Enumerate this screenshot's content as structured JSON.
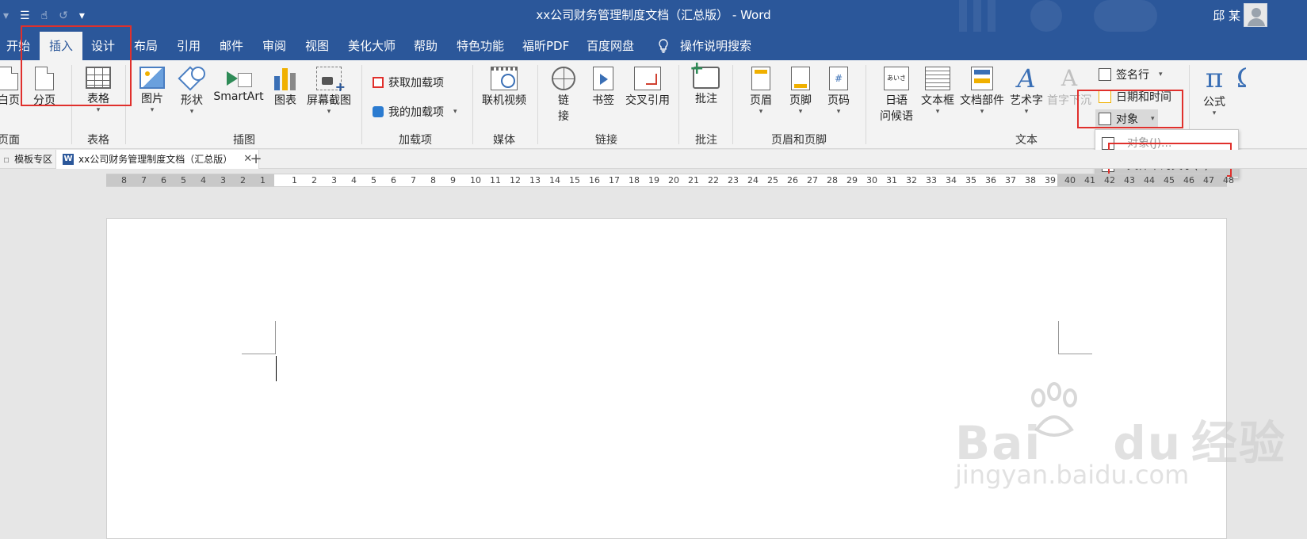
{
  "window": {
    "title": "xx公司财务管理制度文档（汇总版） - Word",
    "user": "邱 某"
  },
  "qat": [
    "customize-icon",
    "touch-mode-icon",
    "undo-icon",
    "more-icon"
  ],
  "tabs": [
    {
      "label": "开始"
    },
    {
      "label": "插入",
      "active": true
    },
    {
      "label": "设计"
    },
    {
      "label": "布局"
    },
    {
      "label": "引用"
    },
    {
      "label": "邮件"
    },
    {
      "label": "审阅"
    },
    {
      "label": "视图"
    },
    {
      "label": "美化大师"
    },
    {
      "label": "帮助"
    },
    {
      "label": "特色功能"
    },
    {
      "label": "福昕PDF"
    },
    {
      "label": "百度网盘"
    },
    {
      "label": "操作说明搜索"
    }
  ],
  "ribbon": {
    "pages": {
      "blank_page": "白页",
      "page_break": "分页",
      "group": "页面"
    },
    "tables": {
      "table": "表格",
      "group": "表格"
    },
    "illustrations": {
      "pictures": "图片",
      "shapes": "形状",
      "smartart": "SmartArt",
      "chart": "图表",
      "screenshot": "屏幕截图",
      "group": "插图"
    },
    "addins": {
      "get_addins": "获取加载项",
      "my_addins": "我的加载项",
      "group": "加载项"
    },
    "media": {
      "online_video": "联机视频",
      "group": "媒体"
    },
    "links": {
      "link_1": "链",
      "link_2": "接",
      "bookmark": "书签",
      "cross_ref": "交叉引用",
      "group": "链接"
    },
    "comments": {
      "comment": "批注",
      "group": "批注"
    },
    "header_footer": {
      "header": "页眉",
      "footer": "页脚",
      "page_number": "页码",
      "group": "页眉和页脚"
    },
    "text": {
      "jp_1": "日语",
      "jp_2": "问候语",
      "textbox": "文本框",
      "quick_parts": "文档部件",
      "wordart": "艺术字",
      "drop_cap": "首字下沉",
      "signature": "签名行",
      "datetime": "日期和时间",
      "object": "对象",
      "group": "文本"
    },
    "symbols": {
      "equation": "公式"
    }
  },
  "object_menu": {
    "items": [
      {
        "label": "对象(J)..."
      },
      {
        "label": "文件中的文字(F)..."
      }
    ]
  },
  "doc_tabs": [
    {
      "label": "模板专区"
    },
    {
      "label": "xx公司财务管理制度文档（汇总版）",
      "active": true
    }
  ],
  "ruler": {
    "left_labels": [
      "8",
      "7",
      "6",
      "5",
      "4",
      "3",
      "2",
      "1"
    ],
    "right_labels": [
      "1",
      "2",
      "3",
      "4",
      "5",
      "6",
      "7",
      "8",
      "9",
      "10",
      "11",
      "12",
      "13",
      "14",
      "15",
      "16",
      "17",
      "18",
      "19",
      "20",
      "21",
      "22",
      "23",
      "24",
      "25",
      "26",
      "27",
      "28",
      "29",
      "30",
      "31",
      "32",
      "33",
      "34",
      "35",
      "36",
      "37",
      "38",
      "39",
      "40",
      "41",
      "42",
      "43",
      "44",
      "45",
      "46",
      "47",
      "48"
    ]
  },
  "watermark": {
    "line1": "Bai",
    "line1b": "du",
    "line1c": "经验",
    "line2": "jingyan.baidu.com"
  },
  "colors": {
    "brand": "#2b579a",
    "highlight": "#e0302c"
  }
}
